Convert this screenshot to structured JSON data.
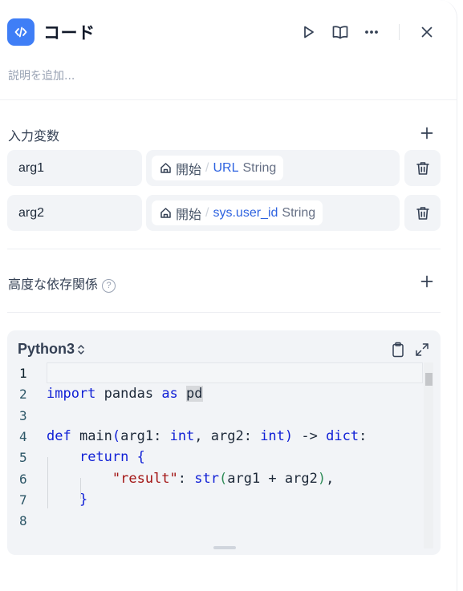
{
  "header": {
    "title": "コード",
    "description_placeholder": "説明を追加..."
  },
  "input_vars": {
    "section_title": "入力変数",
    "items": [
      {
        "name": "arg1",
        "source": "開始",
        "variable": "URL",
        "type": "String"
      },
      {
        "name": "arg2",
        "source": "開始",
        "variable": "sys.user_id",
        "type": "String"
      }
    ]
  },
  "dependencies": {
    "section_title": "高度な依存関係"
  },
  "editor": {
    "language": "Python3",
    "line_numbers": [
      "1",
      "2",
      "3",
      "4",
      "5",
      "6",
      "7",
      "8"
    ]
  },
  "icons": {
    "node": "code-icon",
    "run": "play-icon",
    "docs": "book-open-icon",
    "more": "more-horizontal-icon",
    "close": "close-icon",
    "add": "plus-icon",
    "delete": "trash-icon",
    "help": "question-circle-icon",
    "home": "home-icon",
    "lang_toggle": "chevron-up-down-icon",
    "copy": "clipboard-icon",
    "expand": "expand-icon"
  },
  "colors": {
    "accent": "#3f7ef6",
    "keyword": "#0f1fd6",
    "string": "#a31515",
    "variable_ref": "#2e63e0"
  }
}
